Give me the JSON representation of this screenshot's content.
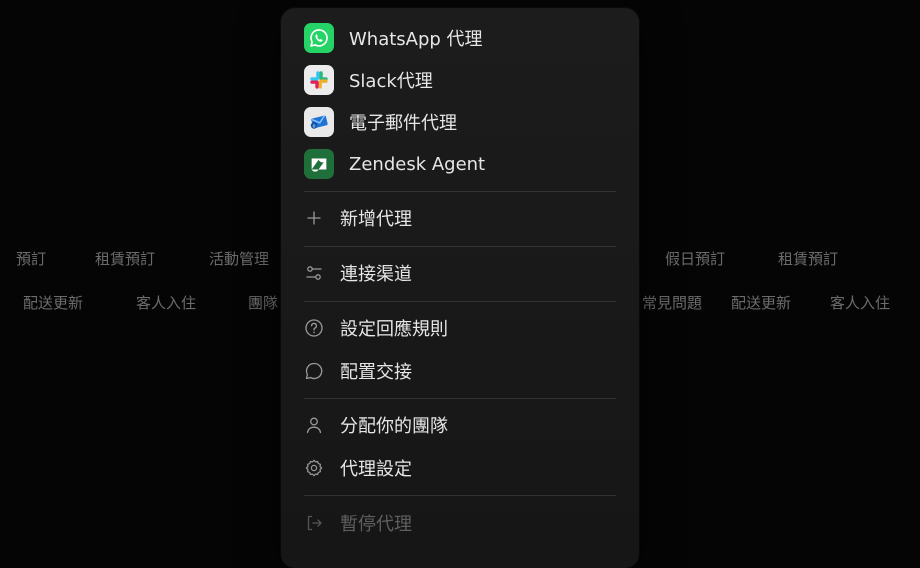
{
  "background": {
    "row1": [
      "預訂",
      "租賃預訂",
      "活動管理",
      "假日預訂",
      "租賃預訂"
    ],
    "row2": [
      "配送更新",
      "客人入住",
      "團隊",
      "常見問題",
      "配送更新",
      "客人入住"
    ]
  },
  "menu": {
    "apps": [
      {
        "label": "WhatsApp 代理",
        "icon": "whatsapp-icon"
      },
      {
        "label": "Slack代理",
        "icon": "slack-icon"
      },
      {
        "label": "電子郵件代理",
        "icon": "email-icon"
      },
      {
        "label": "Zendesk Agent",
        "icon": "zendesk-icon"
      }
    ],
    "actions": {
      "add_agent": "新增代理",
      "connect_channels": "連接渠道",
      "set_reply_rules": "設定回應規則",
      "configure_handoff": "配置交接",
      "assign_team": "分配你的團隊",
      "agent_settings": "代理設定",
      "pause_agent": "暫停代理"
    }
  },
  "colors": {
    "whatsapp": "#25D366",
    "zendesk": "#1F6F3A",
    "menu_bg": "#1a1a1a",
    "text": "#e6e6e6"
  }
}
